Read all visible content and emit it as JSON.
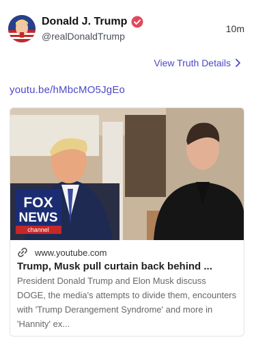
{
  "post": {
    "author": {
      "display_name": "Donald J. Trump",
      "handle": "@realDonaldTrump"
    },
    "time": "10m",
    "details_link": "View Truth Details",
    "url_text": "youtu.be/hMbcMO5JgEo"
  },
  "link_card": {
    "domain": "www.youtube.com",
    "title": "Trump, Musk pull curtain back behind ...",
    "description": "President Donald Trump and Elon Musk discuss DOGE, the media's attempts to divide them, encounters with 'Trump Derangement Syndrome' and more in 'Hannity' ex...",
    "logo_text": [
      "FOX",
      "NEWS",
      "channel"
    ]
  },
  "colors": {
    "link": "#4b47c6",
    "verified": "#e0495d"
  },
  "icons": [
    "verified-badge-icon",
    "chevron-right-icon",
    "link-icon"
  ]
}
